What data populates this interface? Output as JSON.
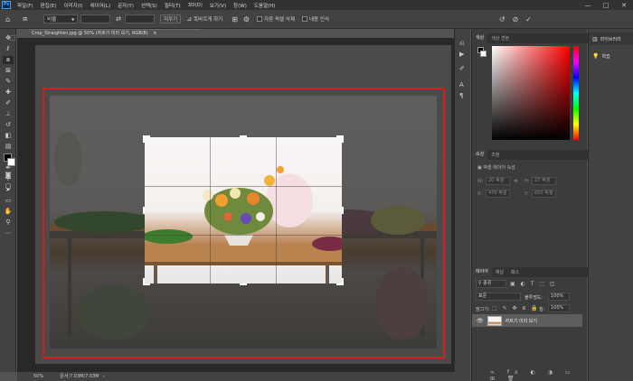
{
  "colors": {
    "accent": "#31a8ff",
    "crop_frame": "#d61d1d",
    "panel_bg": "#3c3c3c"
  },
  "menu": {
    "logo": "Ps",
    "items": [
      "파일(F)",
      "편집(E)",
      "이미지(I)",
      "레이어(L)",
      "문자(Y)",
      "선택(S)",
      "필터(T)",
      "3D(D)",
      "보기(V)",
      "창(W)",
      "도움말(H)"
    ],
    "minimize": "—",
    "maximize": "□",
    "close": "✕"
  },
  "options": {
    "ratio_select": "비율",
    "clear_button": "지우기",
    "straighten_label": "똑바르게 하기",
    "delete_cropped_label": "자른 픽셀 삭제",
    "content_aware_label": "내용 인식",
    "reset_icon": "↺",
    "cancel_icon": "⊘",
    "commit_icon": "✓"
  },
  "document": {
    "tab_title": "Crop_Straighten.jpg @ 50% (자르기 미리 보기, RGB/8)",
    "tab_close": "×",
    "zoom": "50%",
    "doc_info": "문서:7.03M/7.03M"
  },
  "color_panel": {
    "tabs": [
      "색상",
      "색상 견본"
    ]
  },
  "properties_panel": {
    "tabs": [
      "속성",
      "조정"
    ],
    "section": "픽셀 레이어 속성",
    "w_label": "W:",
    "w_value": "20 픽셀",
    "h_label": "H:",
    "h_value": "27 픽셀",
    "x_label": "X:",
    "x_value": "470 픽셀",
    "y_label": "Y:",
    "y_value": "650 픽셀",
    "link_icon": "∞"
  },
  "layers_panel": {
    "tabs": [
      "레이어",
      "채널",
      "패스"
    ],
    "filter_label": "종류",
    "blend_mode": "표준",
    "opacity_label": "불투명도:",
    "opacity_value": "100%",
    "lock_label": "잠그기:",
    "fill_label": "칠:",
    "fill_value": "100%",
    "layer_name": "자르기 미리 보기"
  },
  "far_right": {
    "items": [
      "라이브러리",
      "학습"
    ]
  }
}
